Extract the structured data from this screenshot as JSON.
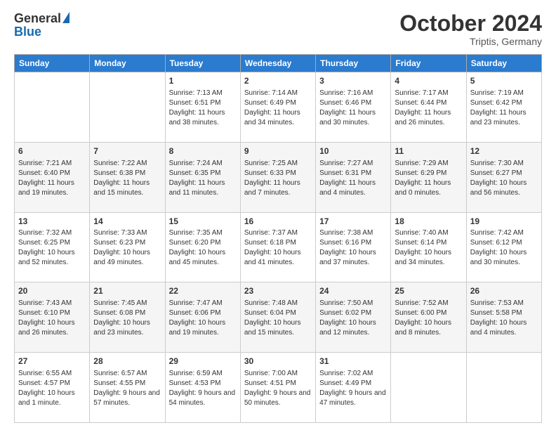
{
  "logo": {
    "general": "General",
    "blue": "Blue"
  },
  "header": {
    "month": "October 2024",
    "location": "Triptis, Germany"
  },
  "days": [
    "Sunday",
    "Monday",
    "Tuesday",
    "Wednesday",
    "Thursday",
    "Friday",
    "Saturday"
  ],
  "weeks": [
    [
      {
        "day": "",
        "sunrise": "",
        "sunset": "",
        "daylight": ""
      },
      {
        "day": "",
        "sunrise": "",
        "sunset": "",
        "daylight": ""
      },
      {
        "day": "1",
        "sunrise": "Sunrise: 7:13 AM",
        "sunset": "Sunset: 6:51 PM",
        "daylight": "Daylight: 11 hours and 38 minutes."
      },
      {
        "day": "2",
        "sunrise": "Sunrise: 7:14 AM",
        "sunset": "Sunset: 6:49 PM",
        "daylight": "Daylight: 11 hours and 34 minutes."
      },
      {
        "day": "3",
        "sunrise": "Sunrise: 7:16 AM",
        "sunset": "Sunset: 6:46 PM",
        "daylight": "Daylight: 11 hours and 30 minutes."
      },
      {
        "day": "4",
        "sunrise": "Sunrise: 7:17 AM",
        "sunset": "Sunset: 6:44 PM",
        "daylight": "Daylight: 11 hours and 26 minutes."
      },
      {
        "day": "5",
        "sunrise": "Sunrise: 7:19 AM",
        "sunset": "Sunset: 6:42 PM",
        "daylight": "Daylight: 11 hours and 23 minutes."
      }
    ],
    [
      {
        "day": "6",
        "sunrise": "Sunrise: 7:21 AM",
        "sunset": "Sunset: 6:40 PM",
        "daylight": "Daylight: 11 hours and 19 minutes."
      },
      {
        "day": "7",
        "sunrise": "Sunrise: 7:22 AM",
        "sunset": "Sunset: 6:38 PM",
        "daylight": "Daylight: 11 hours and 15 minutes."
      },
      {
        "day": "8",
        "sunrise": "Sunrise: 7:24 AM",
        "sunset": "Sunset: 6:35 PM",
        "daylight": "Daylight: 11 hours and 11 minutes."
      },
      {
        "day": "9",
        "sunrise": "Sunrise: 7:25 AM",
        "sunset": "Sunset: 6:33 PM",
        "daylight": "Daylight: 11 hours and 7 minutes."
      },
      {
        "day": "10",
        "sunrise": "Sunrise: 7:27 AM",
        "sunset": "Sunset: 6:31 PM",
        "daylight": "Daylight: 11 hours and 4 minutes."
      },
      {
        "day": "11",
        "sunrise": "Sunrise: 7:29 AM",
        "sunset": "Sunset: 6:29 PM",
        "daylight": "Daylight: 11 hours and 0 minutes."
      },
      {
        "day": "12",
        "sunrise": "Sunrise: 7:30 AM",
        "sunset": "Sunset: 6:27 PM",
        "daylight": "Daylight: 10 hours and 56 minutes."
      }
    ],
    [
      {
        "day": "13",
        "sunrise": "Sunrise: 7:32 AM",
        "sunset": "Sunset: 6:25 PM",
        "daylight": "Daylight: 10 hours and 52 minutes."
      },
      {
        "day": "14",
        "sunrise": "Sunrise: 7:33 AM",
        "sunset": "Sunset: 6:23 PM",
        "daylight": "Daylight: 10 hours and 49 minutes."
      },
      {
        "day": "15",
        "sunrise": "Sunrise: 7:35 AM",
        "sunset": "Sunset: 6:20 PM",
        "daylight": "Daylight: 10 hours and 45 minutes."
      },
      {
        "day": "16",
        "sunrise": "Sunrise: 7:37 AM",
        "sunset": "Sunset: 6:18 PM",
        "daylight": "Daylight: 10 hours and 41 minutes."
      },
      {
        "day": "17",
        "sunrise": "Sunrise: 7:38 AM",
        "sunset": "Sunset: 6:16 PM",
        "daylight": "Daylight: 10 hours and 37 minutes."
      },
      {
        "day": "18",
        "sunrise": "Sunrise: 7:40 AM",
        "sunset": "Sunset: 6:14 PM",
        "daylight": "Daylight: 10 hours and 34 minutes."
      },
      {
        "day": "19",
        "sunrise": "Sunrise: 7:42 AM",
        "sunset": "Sunset: 6:12 PM",
        "daylight": "Daylight: 10 hours and 30 minutes."
      }
    ],
    [
      {
        "day": "20",
        "sunrise": "Sunrise: 7:43 AM",
        "sunset": "Sunset: 6:10 PM",
        "daylight": "Daylight: 10 hours and 26 minutes."
      },
      {
        "day": "21",
        "sunrise": "Sunrise: 7:45 AM",
        "sunset": "Sunset: 6:08 PM",
        "daylight": "Daylight: 10 hours and 23 minutes."
      },
      {
        "day": "22",
        "sunrise": "Sunrise: 7:47 AM",
        "sunset": "Sunset: 6:06 PM",
        "daylight": "Daylight: 10 hours and 19 minutes."
      },
      {
        "day": "23",
        "sunrise": "Sunrise: 7:48 AM",
        "sunset": "Sunset: 6:04 PM",
        "daylight": "Daylight: 10 hours and 15 minutes."
      },
      {
        "day": "24",
        "sunrise": "Sunrise: 7:50 AM",
        "sunset": "Sunset: 6:02 PM",
        "daylight": "Daylight: 10 hours and 12 minutes."
      },
      {
        "day": "25",
        "sunrise": "Sunrise: 7:52 AM",
        "sunset": "Sunset: 6:00 PM",
        "daylight": "Daylight: 10 hours and 8 minutes."
      },
      {
        "day": "26",
        "sunrise": "Sunrise: 7:53 AM",
        "sunset": "Sunset: 5:58 PM",
        "daylight": "Daylight: 10 hours and 4 minutes."
      }
    ],
    [
      {
        "day": "27",
        "sunrise": "Sunrise: 6:55 AM",
        "sunset": "Sunset: 4:57 PM",
        "daylight": "Daylight: 10 hours and 1 minute."
      },
      {
        "day": "28",
        "sunrise": "Sunrise: 6:57 AM",
        "sunset": "Sunset: 4:55 PM",
        "daylight": "Daylight: 9 hours and 57 minutes."
      },
      {
        "day": "29",
        "sunrise": "Sunrise: 6:59 AM",
        "sunset": "Sunset: 4:53 PM",
        "daylight": "Daylight: 9 hours and 54 minutes."
      },
      {
        "day": "30",
        "sunrise": "Sunrise: 7:00 AM",
        "sunset": "Sunset: 4:51 PM",
        "daylight": "Daylight: 9 hours and 50 minutes."
      },
      {
        "day": "31",
        "sunrise": "Sunrise: 7:02 AM",
        "sunset": "Sunset: 4:49 PM",
        "daylight": "Daylight: 9 hours and 47 minutes."
      },
      {
        "day": "",
        "sunrise": "",
        "sunset": "",
        "daylight": ""
      },
      {
        "day": "",
        "sunrise": "",
        "sunset": "",
        "daylight": ""
      }
    ]
  ]
}
